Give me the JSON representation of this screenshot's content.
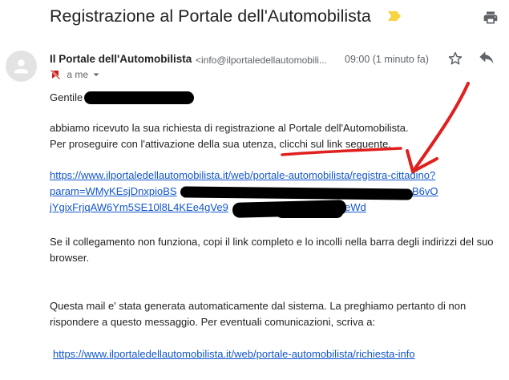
{
  "email": {
    "subject": "Registrazione al Portale dell'Automobilista",
    "sender_name": "Il Portale dell'Automobilista",
    "sender_email": "<info@ilportaledellautomobili...",
    "timestamp": "09:00 (1 minuto fa)",
    "recipient": "a me"
  },
  "body": {
    "greeting": "Gentile",
    "greeting_end": ",",
    "paragraph1_line1": "abbiamo ricevuto la sua richiesta di registrazione al Portale dell'Automobilista.",
    "paragraph1_line2_pre": "Per proseguire con l'attivazione della sua utenza, ",
    "paragraph1_line2_link": "clicchi sul link seguente",
    "paragraph1_line2_post": ".",
    "activation_link_line1": "https://www.ilportaledellautomobilista.it/web/portale-automobilista/registra-cittadino?",
    "activation_link_line2_start": "param=WMyKEsjDnxpioBS",
    "activation_link_line2_end": "B6vO",
    "activation_link_line3_start": "jYgixFrjqAW6Ym5SE10l8L4KEe4gVe9",
    "activation_link_line3_end": "eWd",
    "paragraph2_line1": "Se il collegamento non funziona, copi il link completo e lo incolli nella barra degli indirizzi del suo",
    "paragraph2_line2": "browser.",
    "paragraph3_line1": "Questa mail e' stata generata automaticamente dal sistema. La preghiamo pertanto di non",
    "paragraph3_line2": "rispondere a questo messaggio. Per eventuali comunicazioni, scriva a:",
    "info_link": "https://www.ilportaledellautomobilista.it/web/portale-automobilista/richiesta-info"
  },
  "icons": {
    "label_tag": "label-important-icon",
    "print": "print-icon",
    "star": "star-icon",
    "reply": "reply-icon",
    "recipient_muted": "muted-icon",
    "dropdown": "chevron-down-icon",
    "avatar": "default-avatar-icon"
  },
  "colors": {
    "link": "#1155cc",
    "label_tag": "#f6d443",
    "annotation": "#e0201e",
    "redaction": "#000000"
  }
}
